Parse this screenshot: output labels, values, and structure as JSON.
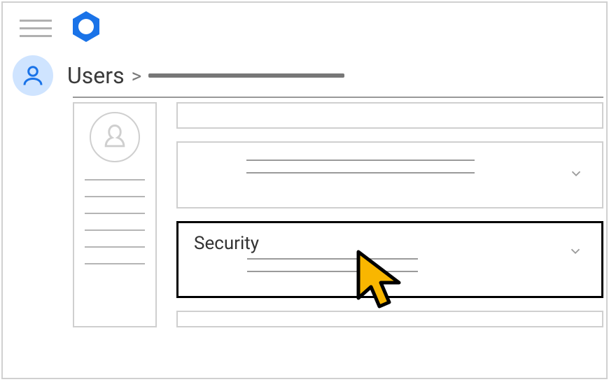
{
  "breadcrumb": {
    "root": "Users",
    "separator": ">"
  },
  "cards": {
    "security": {
      "title": "Security"
    }
  },
  "icons": {
    "menu": "hamburger-icon",
    "settings": "gear-icon",
    "user": "user-avatar-icon",
    "profile": "profile-silhouette-icon",
    "chevron": "chevron-down-icon",
    "cursor": "pointer-cursor"
  },
  "colors": {
    "accent": "#1a73e8",
    "accentLight": "#cfe4ff",
    "cursor": "#f9b600"
  }
}
